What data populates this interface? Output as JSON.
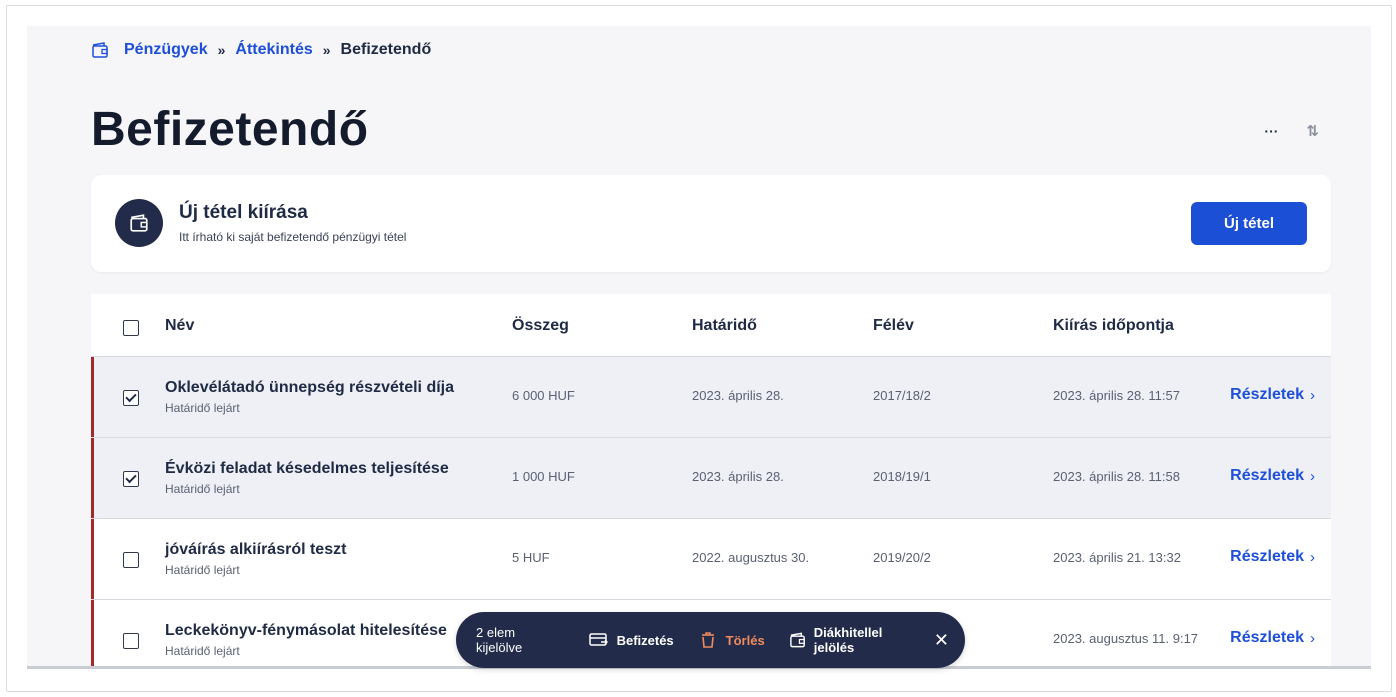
{
  "breadcrumb": {
    "items": [
      "Pénzügyek",
      "Áttekintés"
    ],
    "separator": "»",
    "current": "Befizetendő"
  },
  "page_title": "Befizetendő",
  "title_actions": {
    "more_label": "···",
    "sort_label": "⇅"
  },
  "create_card": {
    "title": "Új tétel kiírása",
    "subtitle": "Itt írható ki saját befizetendő pénzügyi tétel",
    "button_label": "Új tétel"
  },
  "table": {
    "headers": [
      "Név",
      "Összeg",
      "Határidő",
      "Félév",
      "Kiírás időpontja"
    ],
    "details_label": "Részletek",
    "rows": [
      {
        "name": "Oklevélátadó ünnepség részvételi díja",
        "status": "Határidő lejárt",
        "amount": "6 000 HUF",
        "deadline": "2023. április 28.",
        "semester": "2017/18/2",
        "issued": "2023. április 28. 11:57",
        "checked": true
      },
      {
        "name": "Évközi feladat késedelmes teljesítése",
        "status": "Határidő lejárt",
        "amount": "1 000 HUF",
        "deadline": "2023. április 28.",
        "semester": "2018/19/1",
        "issued": "2023. április 28. 11:58",
        "checked": true
      },
      {
        "name": "jóváírás alkiírásról teszt",
        "status": "Határidő lejárt",
        "amount": "5 HUF",
        "deadline": "2022. augusztus 30.",
        "semester": "2019/20/2",
        "issued": "2023. április 21. 13:32",
        "checked": false
      },
      {
        "name": "Leckekönyv-fénymásolat hitelesítése",
        "status": "Határidő lejárt",
        "amount": "",
        "deadline": "",
        "semester": "",
        "issued": "2023. augusztus 11. 9:17",
        "checked": false
      }
    ]
  },
  "action_bar": {
    "count_label": "2 elem kijelölve",
    "pay_label": "Befizetés",
    "delete_label": "Törlés",
    "loan_label": "Diákhitellel jelölés",
    "close_label": "✕"
  },
  "colors": {
    "primary": "#1a4fd6",
    "navy": "#222c4a",
    "danger_bar": "#a12b2b",
    "delete_text": "#f08a5d",
    "selected_row": "#eef0f6"
  }
}
